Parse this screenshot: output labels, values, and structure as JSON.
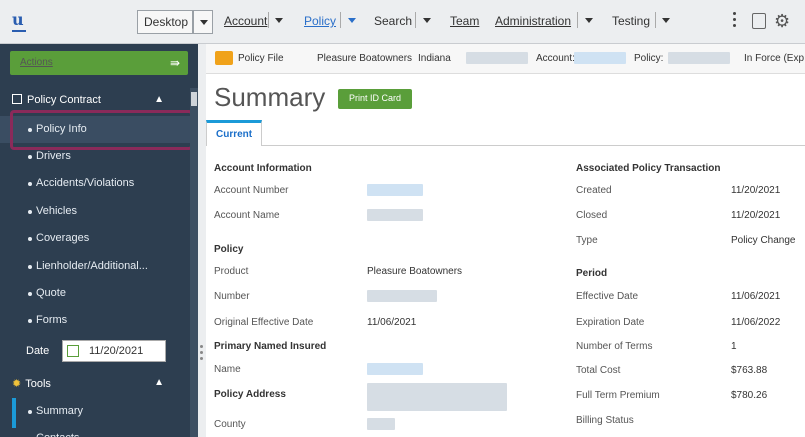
{
  "topbar": {
    "desktop_label": "Desktop",
    "account_label": "Account",
    "policy_label": "Policy",
    "search_label": "Search",
    "team_label": "Team",
    "administration_label": "Administration",
    "testing_label": "Testing"
  },
  "sidebar": {
    "actions_label": "Actions",
    "policy_contract_label": "Policy Contract",
    "items": [
      {
        "label": "Policy Info"
      },
      {
        "label": "Drivers"
      },
      {
        "label": "Accidents/Violations"
      },
      {
        "label": "Vehicles"
      },
      {
        "label": "Coverages"
      },
      {
        "label": "Lienholder/Additional..."
      },
      {
        "label": "Quote"
      },
      {
        "label": "Forms"
      }
    ],
    "date_label": "Date",
    "date_value": "11/20/2021",
    "tools_label": "Tools",
    "tools_items": [
      {
        "label": "Summary"
      },
      {
        "label": "Contacts"
      }
    ]
  },
  "infobar": {
    "policy_file": "Policy File",
    "product": "Pleasure Boatowners",
    "state": "Indiana",
    "account_label": "Account:",
    "policy_label": "Policy:",
    "status": "In Force (Exp"
  },
  "main": {
    "title": "Summary",
    "print_button": "Print ID Card",
    "tab_current": "Current"
  },
  "left_col": {
    "account_info_header": "Account Information",
    "account_number_label": "Account Number",
    "account_name_label": "Account Name",
    "policy_header": "Policy",
    "product_label": "Product",
    "product_value": "Pleasure Boatowners",
    "number_label": "Number",
    "orig_eff_label": "Original Effective Date",
    "orig_eff_value": "11/06/2021",
    "pni_header": "Primary Named Insured",
    "name_label": "Name",
    "policy_address_header": "Policy Address",
    "county_label": "County"
  },
  "right_col": {
    "assoc_header": "Associated Policy Transaction",
    "created_label": "Created",
    "created_value": "11/20/2021",
    "closed_label": "Closed",
    "closed_value": "11/20/2021",
    "type_label": "Type",
    "type_value": "Policy Change",
    "period_header": "Period",
    "eff_label": "Effective Date",
    "eff_value": "11/06/2021",
    "exp_label": "Expiration Date",
    "exp_value": "11/06/2022",
    "terms_label": "Number of Terms",
    "terms_value": "1",
    "total_cost_label": "Total Cost",
    "total_cost_value": "$763.88",
    "ftp_label": "Full Term Premium",
    "ftp_value": "$780.26",
    "billing_label": "Billing Status"
  }
}
